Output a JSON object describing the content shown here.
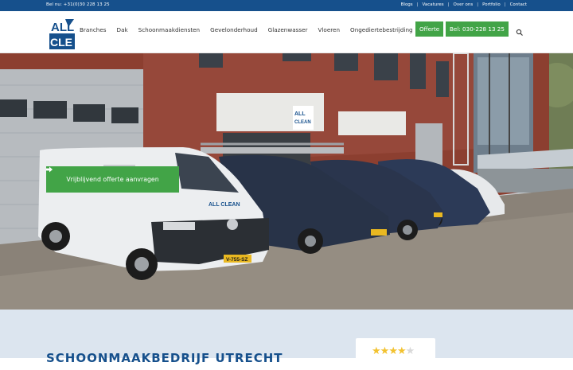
{
  "topbar": {
    "phone": "Bel nu: +31(0)30 228 13 25",
    "links": [
      "Blogs",
      "Vacatures",
      "Over ons",
      "Portfolio",
      "Contact"
    ]
  },
  "header": {
    "logo_text": [
      "ALL",
      "CLE"
    ],
    "nav": [
      "Branches",
      "Dak",
      "Schoonmaakdiensten",
      "Gevelonderhoud",
      "Glazenwasser",
      "Vloeren",
      "Ongediertebestrijding"
    ],
    "offerte_label": "Offerte",
    "bel_label": "Bel: 030-228 13 25",
    "search_icon": "search-icon"
  },
  "hero": {
    "cta_label": "Vrijblijvend offerte aanvragen",
    "cta_icon": "arrow-right-icon",
    "plate_1": "V-755-SZ",
    "van_logo": "ALL CLEAN",
    "building_logo": "ALL CLEAN"
  },
  "section": {
    "title": "SCHOONMAAKBEDRIJF UTRECHT",
    "rating": 4
  },
  "colors": {
    "brand_blue": "#16508c",
    "brand_green": "#42a447",
    "section_bg": "#dce5ef"
  }
}
